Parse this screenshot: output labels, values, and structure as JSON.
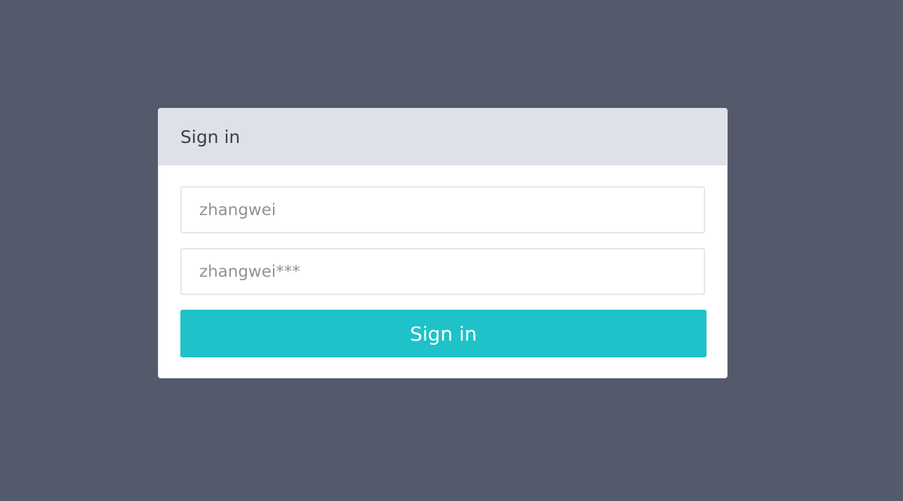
{
  "colors": {
    "background": "#545a6b",
    "header": "#dfe1e8",
    "accent": "#1fc2c8"
  },
  "login": {
    "title": "Sign in",
    "username": {
      "value": "zhangwei"
    },
    "password": {
      "value": "zhangwei***"
    },
    "button_label": "Sign in"
  }
}
